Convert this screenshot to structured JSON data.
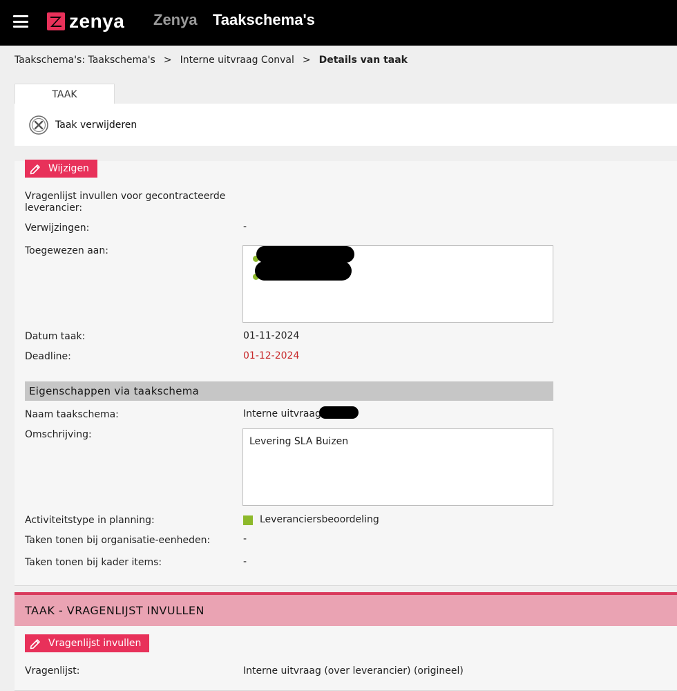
{
  "header": {
    "logo_text": "zenya",
    "app_name": "Zenya",
    "page_title": "Taakschema's"
  },
  "breadcrumb": {
    "items": [
      "Taakschema's: Taakschema's",
      "Interne uitvraag Conval",
      "Details van taak"
    ],
    "separator": ">"
  },
  "tabs": [
    {
      "label": "TAAK"
    }
  ],
  "toolbar": {
    "delete_label": "Taak verwijderen"
  },
  "task": {
    "edit_label": "Wijzigen",
    "fields": {
      "vragenlijst_label": "Vragenlijst invullen voor gecontracteerde leverancier:",
      "verwijzingen_label": "Verwijzingen:",
      "verwijzingen_value": "-",
      "toegewezen_label": "Toegewezen aan:",
      "datum_label": "Datum taak:",
      "datum_value": "01-11-2024",
      "deadline_label": "Deadline:",
      "deadline_value": "01-12-2024"
    }
  },
  "schema_section": {
    "title": "Eigenschappen via taakschema",
    "naam_label": "Naam taakschema:",
    "naam_value": "Interne uitvraag",
    "omschrijving_label": "Omschrijving:",
    "omschrijving_value": "Levering SLA Buizen",
    "activiteit_label": "Activiteitstype in planning:",
    "activiteit_value": "Leveranciersbeoordeling",
    "activiteit_color": "#8db92b",
    "org_label": "Taken tonen bij organisatie-eenheden:",
    "org_value": "-",
    "kader_label": "Taken tonen bij kader items:",
    "kader_value": "-"
  },
  "questionnaire_section": {
    "title": "TAAK - VRAGENLIJST INVULLEN",
    "button_label": "Vragenlijst invullen",
    "vragenlijst_label": "Vragenlijst:",
    "vragenlijst_value": "Interne uitvraag (over leverancier) (origineel)"
  },
  "colors": {
    "accent": "#e8315a",
    "topbar": "#000000",
    "deadline": "#c8292b",
    "section_header": "#eaa3b3"
  }
}
